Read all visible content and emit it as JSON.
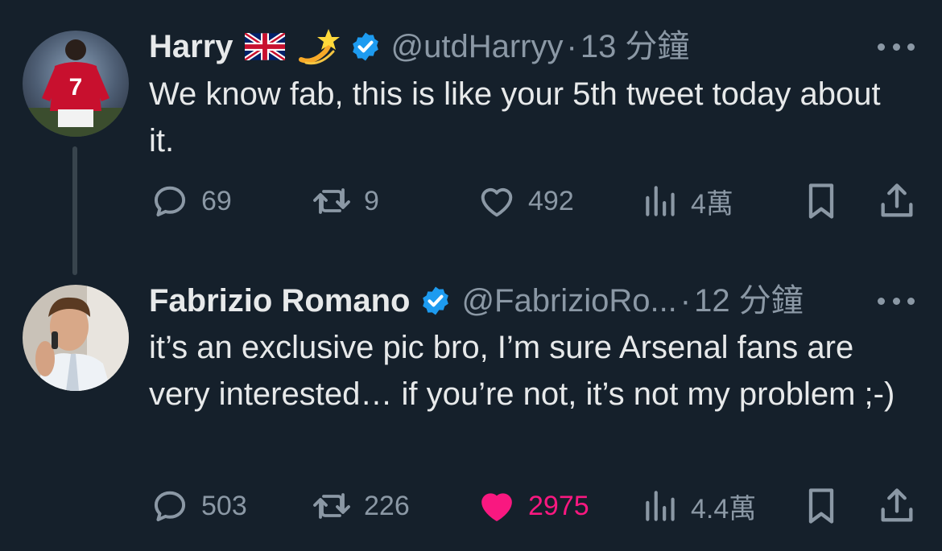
{
  "tweets": [
    {
      "author_name": "Harry",
      "emojis": [
        "flag-uk-emoji",
        "dizzy-star-emoji"
      ],
      "verified": true,
      "handle": "@utdHarryy",
      "separator": "·",
      "time": "13 分鐘",
      "text": "We know fab, this is like your 5th tweet today about it.",
      "stats": {
        "replies": "69",
        "retweets": "9",
        "likes": "492",
        "views": "4萬"
      },
      "liked": false,
      "avatar_jersey_number": "7"
    },
    {
      "author_name": "Fabrizio Romano",
      "verified": true,
      "handle": "@FabrizioRo...",
      "separator": "·",
      "time": "12 分鐘",
      "text": "it’s an exclusive pic bro, I’m sure Arsenal fans are very interested… if you’re not, it’s not my problem ;-)",
      "stats": {
        "replies": "503",
        "retweets": "226",
        "likes": "2975",
        "views": "4.4萬"
      },
      "liked": true
    }
  ],
  "colors": {
    "background": "#15202b",
    "text_primary": "#e7e9ea",
    "text_secondary": "#8b98a5",
    "verified_blue": "#1d9bf0",
    "like_pink": "#f91880"
  }
}
